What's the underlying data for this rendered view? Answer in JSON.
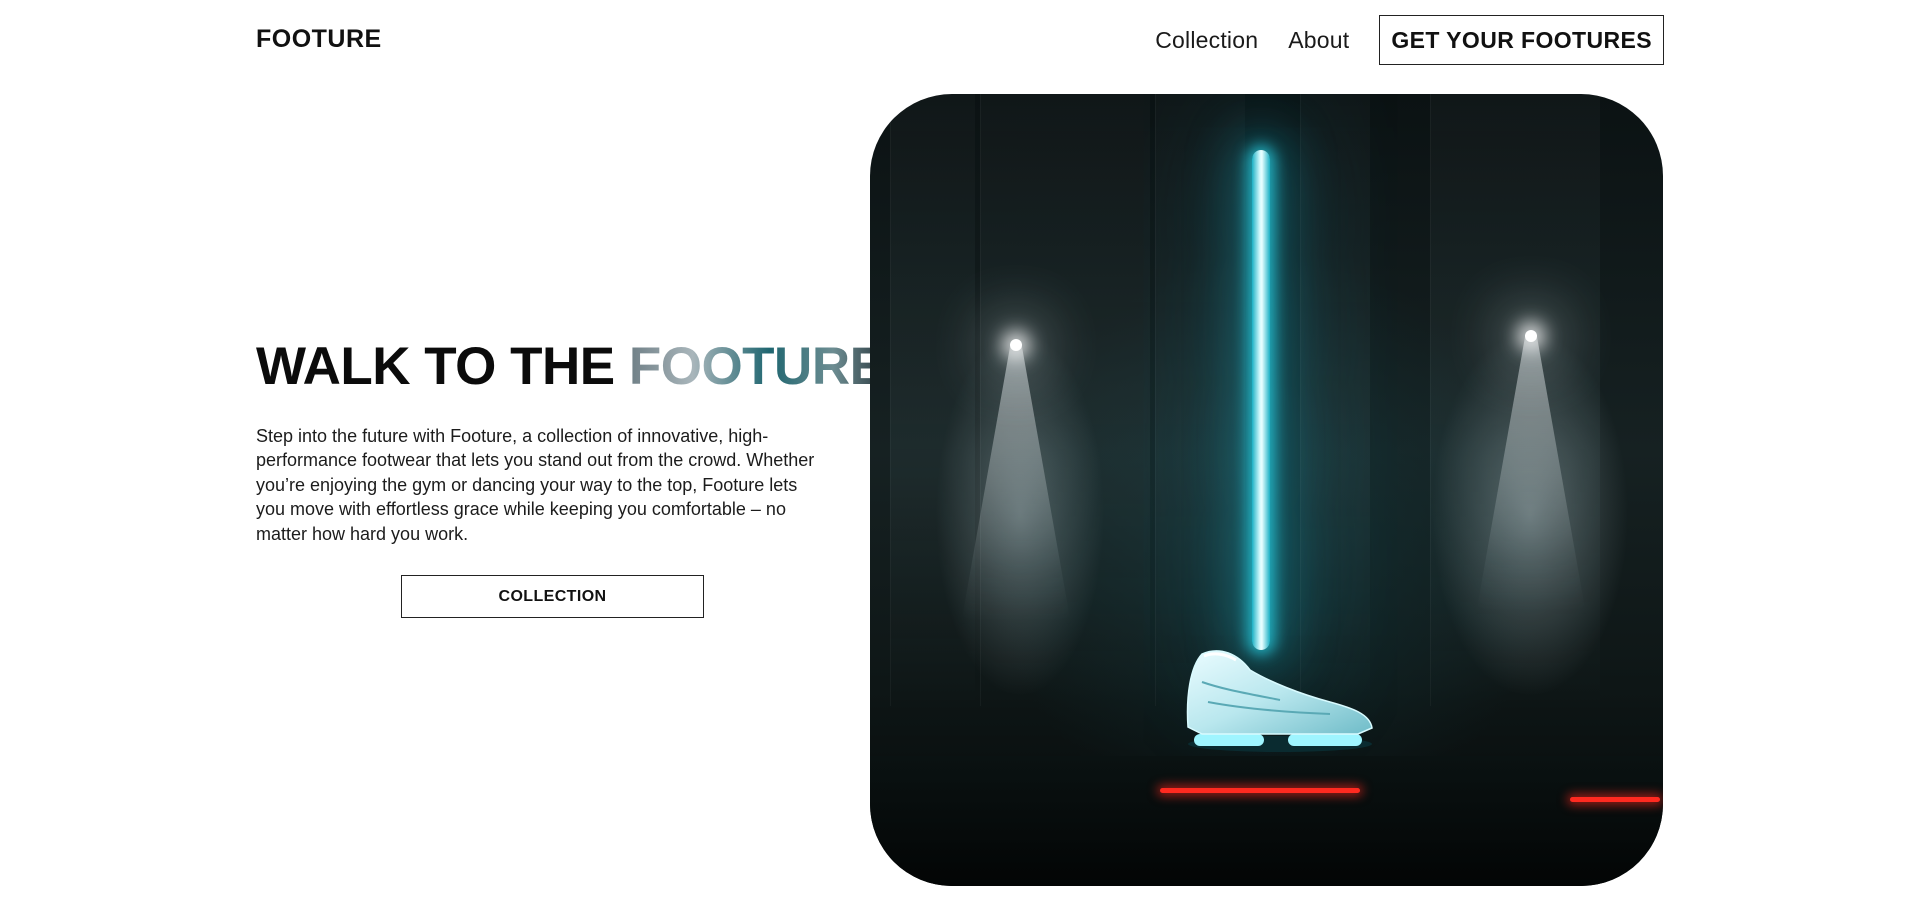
{
  "header": {
    "logo": "FOOTURE",
    "nav": [
      {
        "label": "Collection"
      },
      {
        "label": "About"
      }
    ],
    "cta_label": "GET YOUR FOOTURES"
  },
  "hero": {
    "title_plain": "WALK TO THE ",
    "title_accent": "FOOTURE",
    "description": "Step into the future with Footure, a collection of innovative, high-performance footwear that lets you stand out from the crowd. Whether you’re enjoying the gym or dancing your way to the top, Footure lets you move with effortless grace while keeping you comfortable – no matter how hard you work.",
    "button_label": "COLLECTION"
  },
  "colors": {
    "text": "#111111",
    "background": "#ffffff",
    "neon": "#2fd6e8",
    "accent_red": "#ff2a20"
  }
}
